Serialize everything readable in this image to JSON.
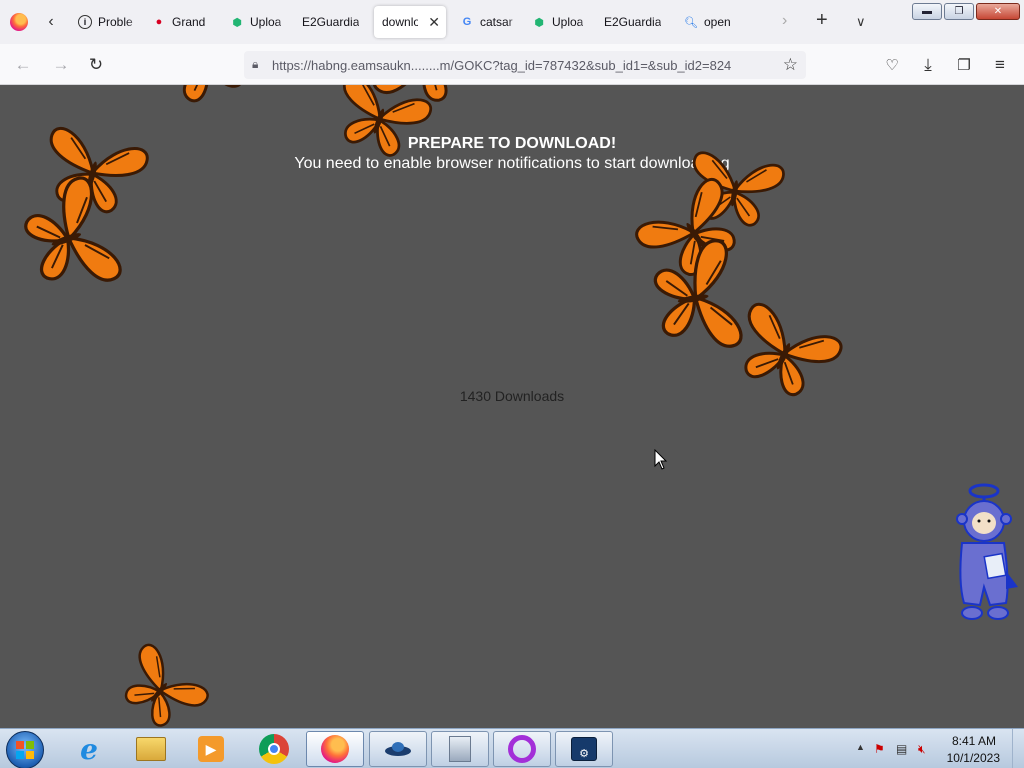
{
  "browser": {
    "tabs": [
      {
        "label": "Proble",
        "icon": "info-icon"
      },
      {
        "label": "Grand",
        "icon": "red-lock-icon"
      },
      {
        "label": "Uploa",
        "icon": "green-upload-icon"
      },
      {
        "label": "E2Guardia",
        "icon": "none"
      },
      {
        "label": "downlo",
        "icon": "none",
        "active": true
      },
      {
        "label": "catsar",
        "icon": "google-icon"
      },
      {
        "label": "Uploa",
        "icon": "green-upload-icon"
      },
      {
        "label": "E2Guardia",
        "icon": "none"
      },
      {
        "label": "open",
        "icon": "search-icon"
      }
    ],
    "url": "https://habng.eamsaukn........m/GOKC?tag_id=787432&sub_id1=&sub_id2=824"
  },
  "page": {
    "title": "PREPARE TO DOWNLOAD!",
    "subtitle": "You need to enable browser notifications to start downloading",
    "downloads": "1430 Downloads"
  },
  "taskbar": {
    "time": "8:41 AM",
    "date": "10/1/2023"
  },
  "colors": {
    "page_bg": "#555555",
    "butterfly_orange": "#f07b10",
    "butterfly_dark": "#3a1a05"
  }
}
